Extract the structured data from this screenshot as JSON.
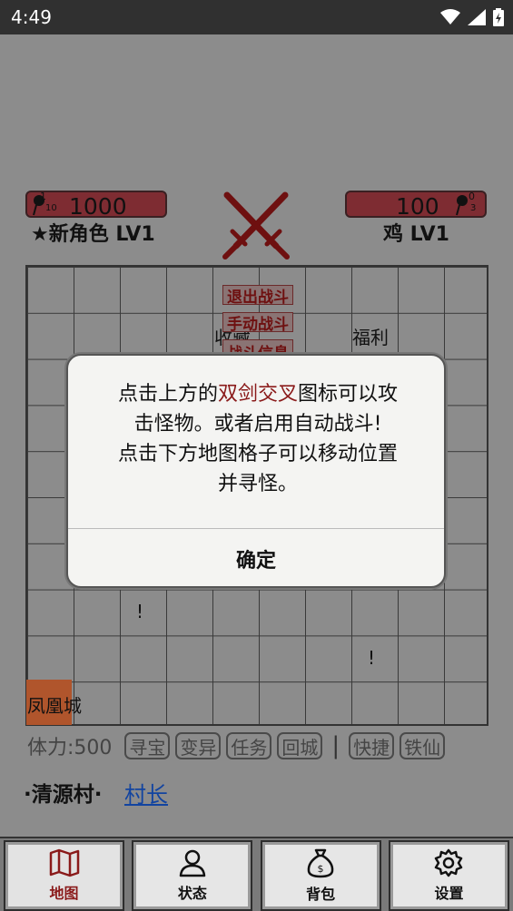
{
  "status_bar": {
    "time": "4:49"
  },
  "player": {
    "hp": "1000",
    "name": "★新角色 LV1",
    "icon_sub": "10",
    "icon_top": "1"
  },
  "enemy": {
    "hp": "100",
    "name": "鸡 LV1",
    "icon_sub": "3",
    "icon_top": "0"
  },
  "battle_menu": {
    "exit": "退出战斗",
    "manual": "手动战斗",
    "info": "战斗信息"
  },
  "map": {
    "collect": "收藏",
    "welfare": "福利",
    "marker1": "!",
    "marker2": "!",
    "city": "凤凰城"
  },
  "actions": {
    "stamina": "体力:500",
    "buttons": [
      "寻宝",
      "变异",
      "任务",
      "回城"
    ],
    "separator": "|",
    "buttons2": [
      "快捷",
      "铁仙"
    ]
  },
  "location": {
    "village": "·清源村·",
    "npc": "村长"
  },
  "dialog": {
    "line1_pre": "点击上方的",
    "line1_highlight": "双剑交叉",
    "line1_post": "图标可以攻",
    "line2": "击怪物。或者启用自动战斗!",
    "line3": "点击下方地图格子可以移动位置",
    "line4": "并寻怪。",
    "ok": "确定"
  },
  "nav": {
    "map": "地图",
    "status": "状态",
    "bag": "背包",
    "settings": "设置"
  },
  "colors": {
    "accent": "#8a1a1a",
    "hp_bar": "#7e2c32",
    "city": "#b0552c",
    "link": "#1244a0"
  }
}
